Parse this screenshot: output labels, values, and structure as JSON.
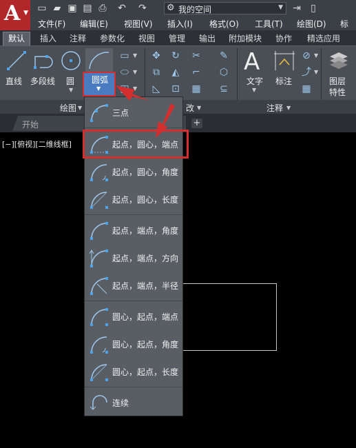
{
  "quick_access": {
    "workspace": "我的空间",
    "icons": [
      "new-icon",
      "open-icon",
      "save-icon",
      "saveas-icon",
      "print-icon",
      "undo-icon",
      "redo-icon",
      "gear-icon",
      "share-icon",
      "account-icon"
    ]
  },
  "menubar": {
    "items": [
      "文件(F)",
      "编辑(E)",
      "视图(V)",
      "插入(I)",
      "格式(O)",
      "工具(T)",
      "绘图(D)",
      "标注"
    ]
  },
  "ribbon_tabs": [
    "默认",
    "插入",
    "注释",
    "参数化",
    "视图",
    "管理",
    "输出",
    "附加模块",
    "协作",
    "精选应用"
  ],
  "ribbon": {
    "draw_tools": [
      "直线",
      "多段线",
      "圆"
    ],
    "arc_button": "圆弧",
    "annotation_tools": [
      "文字",
      "标注"
    ],
    "layer_tool": [
      "图层",
      "特性"
    ],
    "panels": {
      "draw": "绘图",
      "modify": "改",
      "annotate": "注释"
    }
  },
  "doc_tabs": {
    "start": "开始",
    "add": "+"
  },
  "viewport_label": "[−][俯视][二维线框]",
  "arc_menu": {
    "items": [
      "三点",
      "起点，圆心，端点",
      "起点，圆心，角度",
      "起点，圆心，长度",
      "起点，端点，角度",
      "起点，端点，方向",
      "起点，端点，半径",
      "圆心，起点，端点",
      "圆心，起点，角度",
      "圆心，起点，长度",
      "连续"
    ]
  },
  "colors": {
    "highlight": "#d32f2f",
    "accent": "#4a7bc0",
    "logo": "#b2272a"
  }
}
